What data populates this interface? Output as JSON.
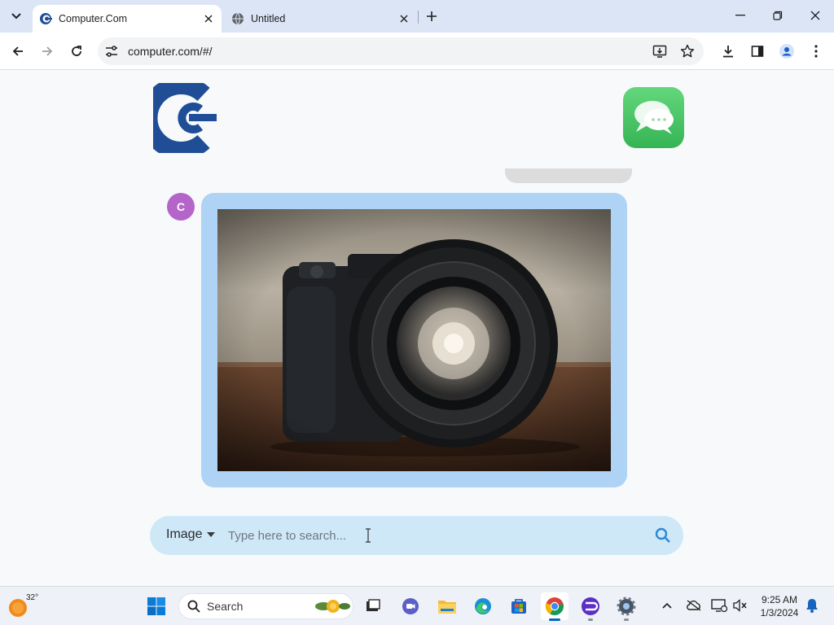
{
  "browser": {
    "tabs": [
      {
        "title": "Computer.Com",
        "active": true
      },
      {
        "title": "Untitled",
        "active": false
      }
    ],
    "url": "computer.com/#/"
  },
  "page": {
    "avatar_letter": "C",
    "search": {
      "mode": "Image",
      "placeholder": "Type here to search...",
      "value": ""
    }
  },
  "taskbar": {
    "weather_temp": "32°",
    "search_label": "Search",
    "time": "9:25 AM",
    "date": "1/3/2024",
    "apps": [
      "start-icon",
      "task-view-icon",
      "meet-icon",
      "file-explorer-icon",
      "edge-icon",
      "store-icon",
      "chrome-icon",
      "app-icon",
      "settings-icon"
    ]
  },
  "colors": {
    "card_bg": "#aed3f5",
    "search_bg": "#cfe8f8",
    "avatar": "#b565c9",
    "logo_blue": "#1f4e96",
    "messages_green": "#4cc764"
  }
}
